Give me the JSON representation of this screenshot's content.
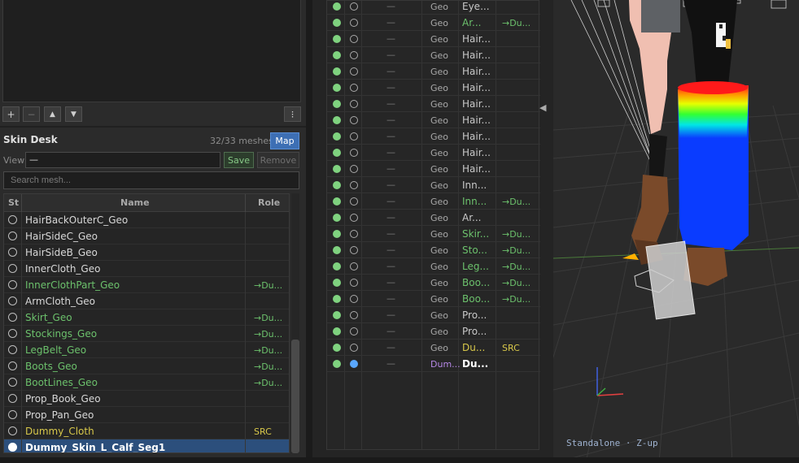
{
  "toolbar": {
    "add": "+",
    "remove": "−",
    "up": "▲",
    "down": "▼",
    "menu": "⁝"
  },
  "skin_desk": {
    "title": "Skin Desk",
    "count": "32/33 meshes",
    "map_label": "Map",
    "view_label": "View",
    "view_value": "—",
    "save_label": "Save",
    "remove_label": "Remove",
    "search_placeholder": "Search mesh..."
  },
  "left_table": {
    "columns": {
      "st": "St",
      "name": "Name",
      "role": "Role"
    },
    "rows": [
      {
        "name": "HairBackOuterC_Geo",
        "role": "",
        "style": ""
      },
      {
        "name": "HairSideC_Geo",
        "role": "",
        "style": ""
      },
      {
        "name": "HairSideB_Geo",
        "role": "",
        "style": ""
      },
      {
        "name": "InnerCloth_Geo",
        "role": "",
        "style": ""
      },
      {
        "name": "InnerClothPart_Geo",
        "role": "→Du...",
        "style": "green"
      },
      {
        "name": "ArmCloth_Geo",
        "role": "",
        "style": ""
      },
      {
        "name": "Skirt_Geo",
        "role": "→Du...",
        "style": "green"
      },
      {
        "name": "Stockings_Geo",
        "role": "→Du...",
        "style": "green"
      },
      {
        "name": "LegBelt_Geo",
        "role": "→Du...",
        "style": "green"
      },
      {
        "name": "Boots_Geo",
        "role": "→Du...",
        "style": "green"
      },
      {
        "name": "BootLines_Geo",
        "role": "→Du...",
        "style": "green"
      },
      {
        "name": "Prop_Book_Geo",
        "role": "",
        "style": ""
      },
      {
        "name": "Prop_Pan_Geo",
        "role": "",
        "style": ""
      },
      {
        "name": "Dummy_Cloth",
        "role": "SRC",
        "style": "yellow"
      },
      {
        "name": "Dummy_Skin_L_Calf_Seg1",
        "role": "",
        "style": "sel"
      }
    ]
  },
  "mid_table": {
    "rows": [
      {
        "dash": "—",
        "type": "Geo",
        "name": "Eye...",
        "role": "",
        "style": ""
      },
      {
        "dash": "—",
        "type": "Geo",
        "name": "Ar...",
        "role": "→Du...",
        "style": "green"
      },
      {
        "dash": "—",
        "type": "Geo",
        "name": "Hair...",
        "role": "",
        "style": ""
      },
      {
        "dash": "—",
        "type": "Geo",
        "name": "Hair...",
        "role": "",
        "style": ""
      },
      {
        "dash": "—",
        "type": "Geo",
        "name": "Hair...",
        "role": "",
        "style": ""
      },
      {
        "dash": "—",
        "type": "Geo",
        "name": "Hair...",
        "role": "",
        "style": ""
      },
      {
        "dash": "—",
        "type": "Geo",
        "name": "Hair...",
        "role": "",
        "style": ""
      },
      {
        "dash": "—",
        "type": "Geo",
        "name": "Hair...",
        "role": "",
        "style": ""
      },
      {
        "dash": "—",
        "type": "Geo",
        "name": "Hair...",
        "role": "",
        "style": ""
      },
      {
        "dash": "—",
        "type": "Geo",
        "name": "Hair...",
        "role": "",
        "style": ""
      },
      {
        "dash": "—",
        "type": "Geo",
        "name": "Hair...",
        "role": "",
        "style": ""
      },
      {
        "dash": "—",
        "type": "Geo",
        "name": "Inn...",
        "role": "",
        "style": ""
      },
      {
        "dash": "—",
        "type": "Geo",
        "name": "Inn...",
        "role": "→Du...",
        "style": "green"
      },
      {
        "dash": "—",
        "type": "Geo",
        "name": "Ar...",
        "role": "",
        "style": ""
      },
      {
        "dash": "—",
        "type": "Geo",
        "name": "Skir...",
        "role": "→Du...",
        "style": "green"
      },
      {
        "dash": "—",
        "type": "Geo",
        "name": "Sto...",
        "role": "→Du...",
        "style": "green"
      },
      {
        "dash": "—",
        "type": "Geo",
        "name": "Leg...",
        "role": "→Du...",
        "style": "green"
      },
      {
        "dash": "—",
        "type": "Geo",
        "name": "Boo...",
        "role": "→Du...",
        "style": "green"
      },
      {
        "dash": "—",
        "type": "Geo",
        "name": "Boo...",
        "role": "→Du...",
        "style": "green"
      },
      {
        "dash": "—",
        "type": "Geo",
        "name": "Pro...",
        "role": "",
        "style": ""
      },
      {
        "dash": "—",
        "type": "Geo",
        "name": "Pro...",
        "role": "",
        "style": ""
      },
      {
        "dash": "—",
        "type": "Geo",
        "name": "Du...",
        "role": "SRC",
        "style": "yellow"
      },
      {
        "dash": "—",
        "type": "Dum...",
        "name": "Du...",
        "role": "",
        "style": "sel"
      }
    ]
  },
  "viewport": {
    "status": "Standalone  ·  Z-up",
    "collapse_icon": "◀"
  },
  "colors": {
    "accent": "#3d6fb4",
    "assigned": "#6cc16c",
    "source": "#d8c84a",
    "selected_row": "#2c4f7c"
  }
}
